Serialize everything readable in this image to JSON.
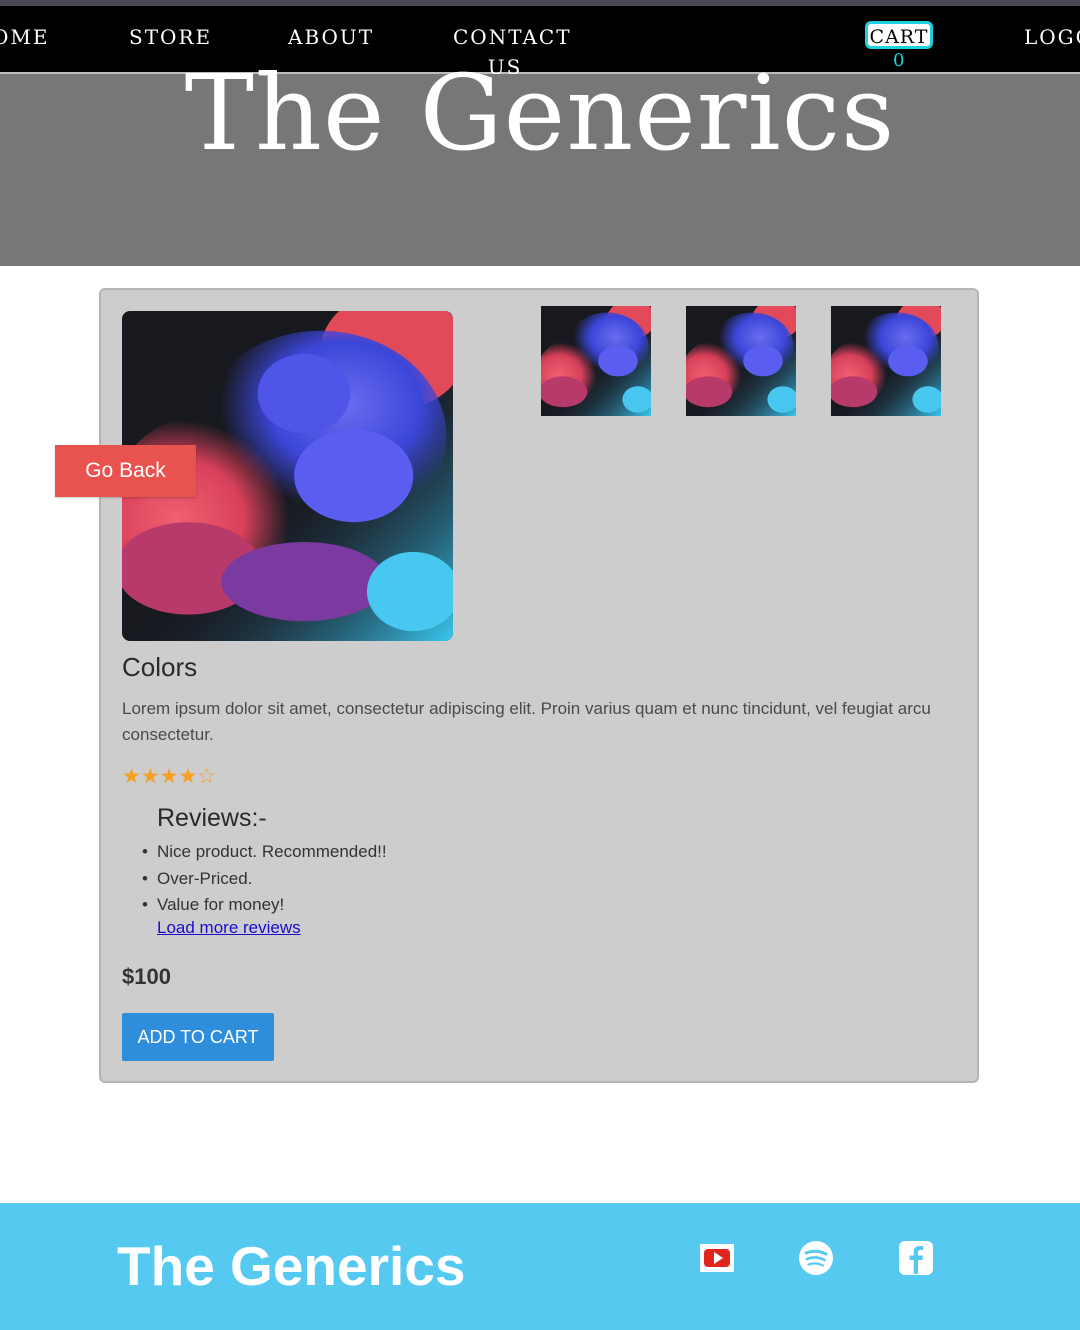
{
  "nav": {
    "home": "OME",
    "store": "STORE",
    "about": "ABOUT",
    "contact": "CONTACT US",
    "cart_label": "CART",
    "cart_count": "0",
    "logo": "LOGO"
  },
  "hero": {
    "title": "The Generics"
  },
  "product": {
    "go_back": "Go Back",
    "title": "Colors",
    "description": "Lorem ipsum dolor sit amet, consectetur adipiscing elit. Proin varius quam et nunc tincidunt, vel feugiat arcu consectetur.",
    "rating_stars": "★★★★☆",
    "rating": 4,
    "rating_max": 5,
    "reviews_heading": "Reviews:-",
    "reviews": [
      "Nice product. Recommended!!",
      "Over-Priced.",
      "Value for money!"
    ],
    "load_more": "Load more reviews",
    "price": "$100",
    "add_to_cart": "ADD TO CART"
  },
  "footer": {
    "title": "The Generics",
    "icons": [
      "youtube-icon",
      "spotify-icon",
      "facebook-icon"
    ]
  },
  "colors": {
    "nav_bg": "#000000",
    "cart_border": "#1fd0e0",
    "hero_bg": "#777777",
    "card_bg": "#cdcdcd",
    "go_back_bg": "#e8524f",
    "add_to_cart_bg": "#2f8edb",
    "star": "#f5a020",
    "footer_bg": "#56c9f0"
  }
}
